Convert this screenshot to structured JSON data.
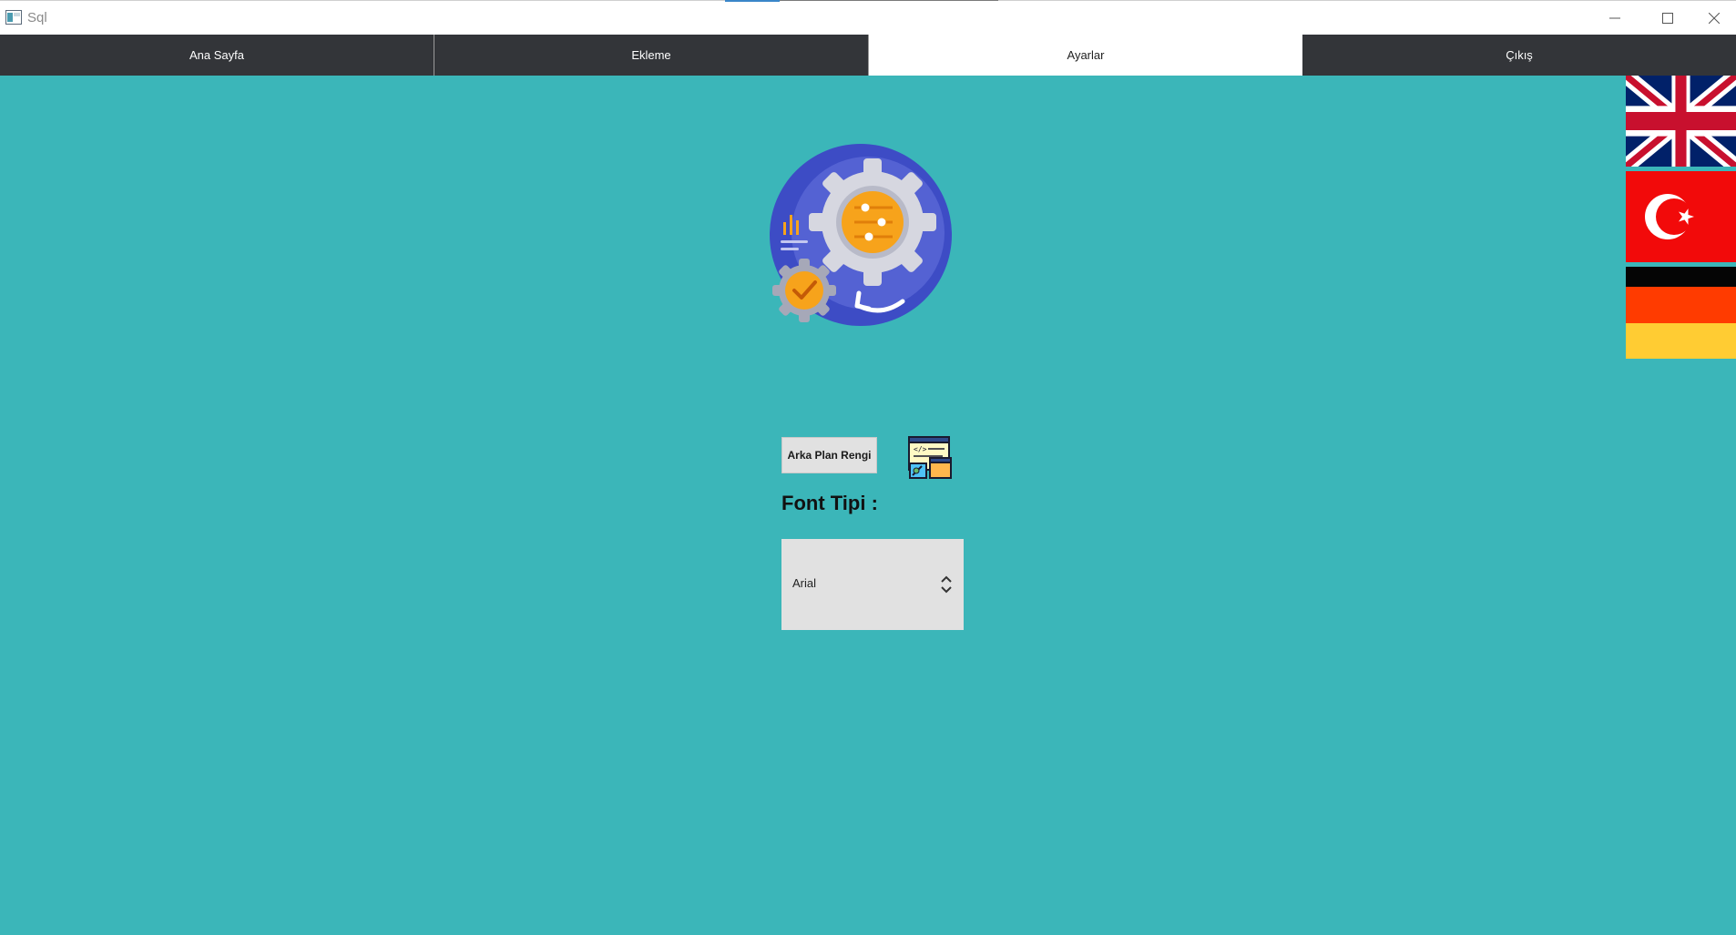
{
  "window": {
    "title": "Sql",
    "icons": {
      "app": "app-window-icon",
      "minimize": "minimize-icon",
      "maximize": "maximize-icon",
      "close": "close-icon"
    }
  },
  "tabs": [
    {
      "label": "Ana Sayfa",
      "active": false
    },
    {
      "label": "Ekleme",
      "active": false
    },
    {
      "label": "Ayarlar",
      "active": true
    },
    {
      "label": "Çıkış",
      "active": false
    }
  ],
  "flags": [
    "united-kingdom-flag",
    "turkey-flag",
    "germany-flag"
  ],
  "settings": {
    "illustration": "settings-gear-icon",
    "background_color_button": "Arka Plan Rengi",
    "code_icon": "code-window-icon",
    "font_label": "Font Tipi :",
    "font_select": {
      "value": "Arial",
      "icon": "updown-chevron-icon"
    }
  },
  "colors": {
    "background": "#3bb6b9",
    "tabbar": "#333539",
    "active_tab": "#ffffff"
  }
}
